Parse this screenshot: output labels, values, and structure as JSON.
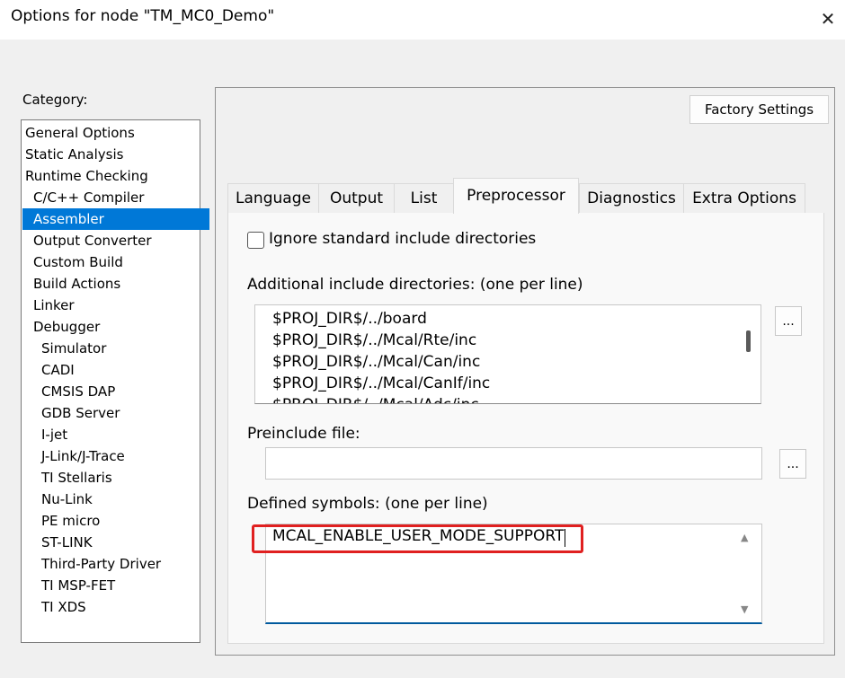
{
  "window": {
    "title": "Options for node \"TM_MC0_Demo\"",
    "close_glyph": "✕"
  },
  "category": {
    "label": "Category:",
    "selected": "Assembler",
    "items": [
      "General Options",
      "Static Analysis",
      "Runtime Checking",
      "C/C++ Compiler",
      "Assembler",
      "Output Converter",
      "Custom Build",
      "Build Actions",
      "Linker",
      "Debugger",
      "Simulator",
      "CADI",
      "CMSIS DAP",
      "GDB Server",
      "I-jet",
      "J-Link/J-Trace",
      "TI Stellaris",
      "Nu-Link",
      "PE micro",
      "ST-LINK",
      "Third-Party Driver",
      "TI MSP-FET",
      "TI XDS"
    ]
  },
  "factory_settings_label": "Factory Settings",
  "tabs": [
    {
      "label": "Language"
    },
    {
      "label": "Output"
    },
    {
      "label": "List"
    },
    {
      "label": "Preprocessor",
      "active": true
    },
    {
      "label": "Diagnostics"
    },
    {
      "label": "Extra Options"
    }
  ],
  "preprocessor": {
    "ignore_std_label": "Ignore standard include directories",
    "ignore_std_checked": false,
    "include_dirs_label": "Additional include directories:  (one per line)",
    "include_dirs": [
      "$PROJ_DIR$/../board",
      "$PROJ_DIR$/../Mcal/Rte/inc",
      "$PROJ_DIR$/../Mcal/Can/inc",
      "$PROJ_DIR$/../Mcal/CanIf/inc",
      "$PROJ_DIR$/../Mcal/Adc/inc"
    ],
    "browse_label": "...",
    "preinclude_label": "Preinclude file:",
    "preinclude_value": "",
    "defined_symbols_label": "Defined symbols:  (one per line)",
    "defined_symbols": "MCAL_ENABLE_USER_MODE_SUPPORT"
  },
  "icons": {
    "scroll_up": "▲",
    "scroll_down": "▼"
  },
  "colors": {
    "selection": "#0078d7",
    "highlight_box": "#e02020",
    "focus_underline": "#005a9e"
  }
}
